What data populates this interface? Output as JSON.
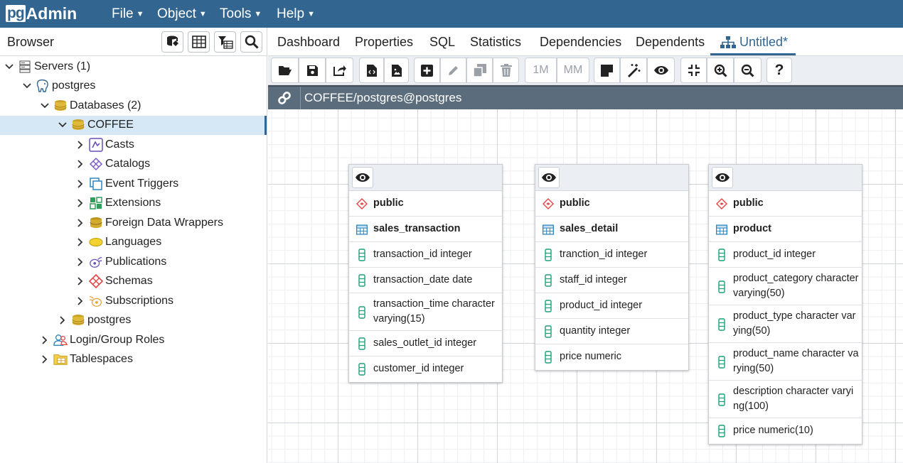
{
  "app": {
    "logo_pg": "pg",
    "logo_admin": "Admin"
  },
  "menu": [
    {
      "label": "File"
    },
    {
      "label": "Object"
    },
    {
      "label": "Tools"
    },
    {
      "label": "Help"
    }
  ],
  "browser": {
    "title": "Browser",
    "buttons": [
      "database-icon",
      "table-icon",
      "filter-icon",
      "search-icon"
    ]
  },
  "tree": [
    {
      "label": "Servers (1)",
      "level": 0,
      "icon": "servers-icon",
      "expanded": true
    },
    {
      "label": "postgres",
      "level": 1,
      "icon": "elephant-icon",
      "expanded": true
    },
    {
      "label": "Databases (2)",
      "level": 2,
      "icon": "databases-icon",
      "expanded": true
    },
    {
      "label": "COFFEE",
      "level": 3,
      "icon": "database-icon",
      "expanded": true,
      "selected": true
    },
    {
      "label": "Casts",
      "level": 4,
      "icon": "casts-icon",
      "expanded": false
    },
    {
      "label": "Catalogs",
      "level": 4,
      "icon": "catalogs-icon",
      "expanded": false
    },
    {
      "label": "Event Triggers",
      "level": 4,
      "icon": "event-triggers-icon",
      "expanded": false
    },
    {
      "label": "Extensions",
      "level": 4,
      "icon": "extensions-icon",
      "expanded": false
    },
    {
      "label": "Foreign Data Wrappers",
      "level": 4,
      "icon": "fdw-icon",
      "expanded": false
    },
    {
      "label": "Languages",
      "level": 4,
      "icon": "languages-icon",
      "expanded": false
    },
    {
      "label": "Publications",
      "level": 4,
      "icon": "publications-icon",
      "expanded": false
    },
    {
      "label": "Schemas",
      "level": 4,
      "icon": "schemas-icon",
      "expanded": false
    },
    {
      "label": "Subscriptions",
      "level": 4,
      "icon": "subscriptions-icon",
      "expanded": false
    },
    {
      "label": "postgres",
      "level": 3,
      "icon": "database-icon",
      "expanded": false
    },
    {
      "label": "Login/Group Roles",
      "level": 2,
      "icon": "roles-icon",
      "expanded": false
    },
    {
      "label": "Tablespaces",
      "level": 2,
      "icon": "tablespaces-icon",
      "expanded": false
    }
  ],
  "tabs": [
    {
      "label": "Dashboard"
    },
    {
      "label": "Properties"
    },
    {
      "label": "SQL"
    },
    {
      "label": "Statistics"
    },
    {
      "label": "Dependencies"
    },
    {
      "label": "Dependents"
    },
    {
      "label": "Untitled*",
      "active": true
    }
  ],
  "toolbar": {
    "one_to_many": "1M",
    "many_to_many": "MM"
  },
  "connection": {
    "label": "COFFEE/postgres@postgres"
  },
  "entities": [
    {
      "schema": "public",
      "table": "sales_transaction",
      "columns": [
        "transaction_id integer",
        "transaction_date date",
        "transaction_time character varying(15)",
        "sales_outlet_id integer",
        "customer_id integer"
      ]
    },
    {
      "schema": "public",
      "table": "sales_detail",
      "columns": [
        "tranction_id integer",
        "staff_id integer",
        "product_id integer",
        "quantity integer",
        "price numeric"
      ]
    },
    {
      "schema": "public",
      "table": "product",
      "columns": [
        "product_id integer",
        "product_category character varying(50)",
        "product_type character varying(50)",
        "product_name character varying(50)",
        "description character varying(100)",
        "price numeric(10)"
      ]
    }
  ],
  "colors": {
    "brand": "#326690",
    "connbar": "#5b6d7c",
    "selected": "#d6e7f5"
  }
}
